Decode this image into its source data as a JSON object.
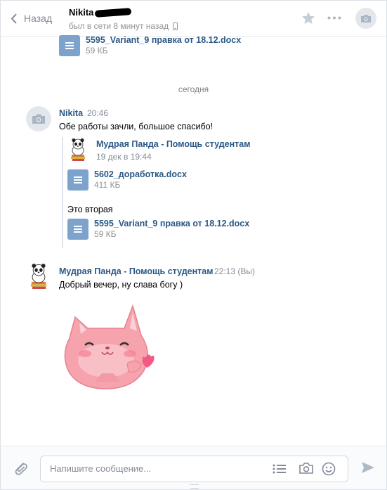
{
  "header": {
    "back_label": "Назад",
    "peer_name": "Nikita",
    "peer_status": "был в сети 8 минут назад"
  },
  "top_doc": {
    "name": "5595_Variant_9 правка от 18.12.docx",
    "size": "59 КБ"
  },
  "date_separator": "сегодня",
  "message1": {
    "author": "Nikita",
    "time": "20:46",
    "text": "Обе работы зачли, большое спасибо!",
    "forward": {
      "author": "Мудрая Панда - Помощь студентам",
      "date": "19 дек в 19:44",
      "doc1": {
        "name": "5602_доработка.docx",
        "size": "411 КБ"
      },
      "text": "Это вторая",
      "doc2": {
        "name": "5595_Variant_9 правка от 18.12.docx",
        "size": "59 КБ"
      }
    }
  },
  "message2": {
    "author": "Мудрая Панда - Помощь студентам",
    "time": "22:13",
    "mine_label": "(Вы)",
    "text": "Добрый вечер, ну слава богу )"
  },
  "compose": {
    "placeholder": "Напишите сообщение..."
  },
  "colors": {
    "link": "#2a5885",
    "doc_icon": "#7da3cd",
    "muted": "#828a99"
  }
}
